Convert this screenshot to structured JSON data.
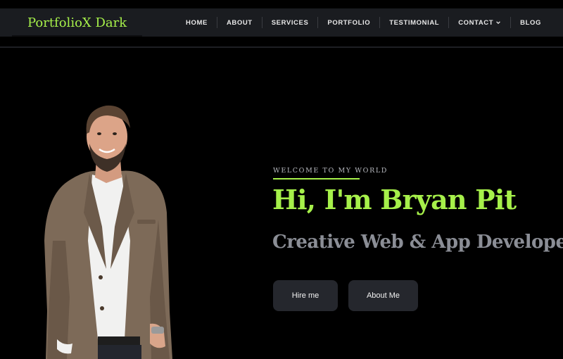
{
  "header": {
    "logo": "PortfolioX Dark",
    "nav": [
      {
        "label": "HOME"
      },
      {
        "label": "ABOUT"
      },
      {
        "label": "SERVICES"
      },
      {
        "label": "PORTFOLIO"
      },
      {
        "label": "TESTIMONIAL"
      },
      {
        "label": "CONTACT",
        "icon": "chevron-down-icon"
      },
      {
        "label": "BLOG"
      }
    ]
  },
  "hero": {
    "eyebrow": "WELCOME TO MY WORLD",
    "title": "Hi, I'm Bryan Pit",
    "subtitle": "Creative Web & App Developer",
    "buttons": {
      "hire": "Hire me",
      "about": "About Me"
    },
    "photo_icon": "person-photo"
  },
  "colors": {
    "accent": "#a6f04a",
    "background": "#000000",
    "header": "#1a1c20",
    "button": "#25272d",
    "subtitle": "#8b8e96"
  }
}
